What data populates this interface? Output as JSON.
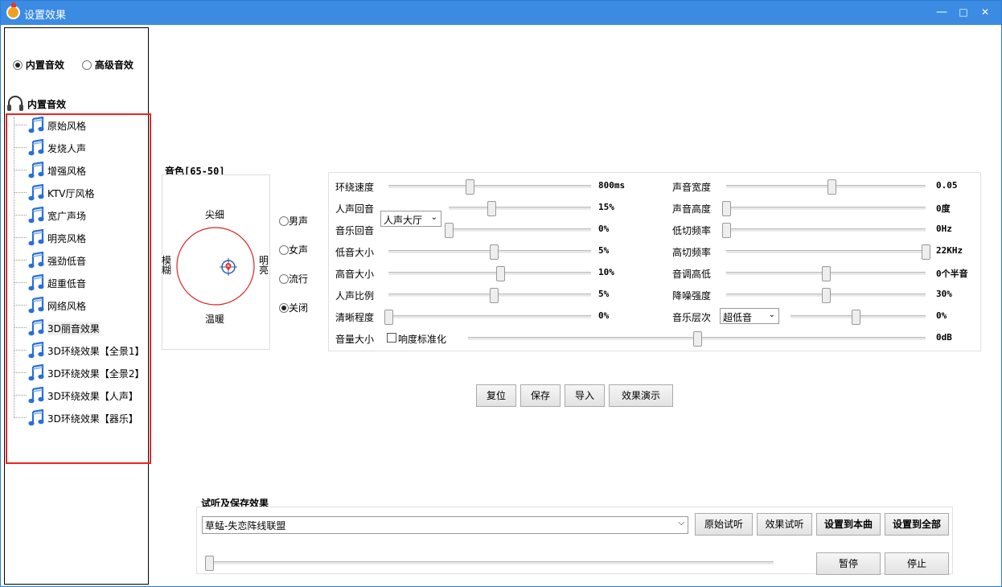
{
  "window": {
    "title": "设置效果",
    "minimize": "—",
    "maximize": "□",
    "close": "✕"
  },
  "mode": {
    "builtin_label": "内置音效",
    "advanced_label": "高级音效",
    "selected": "builtin"
  },
  "tree": {
    "root_label": "内置音效",
    "items": [
      "原始风格",
      "发烧人声",
      "增强风格",
      "KTV厅风格",
      "宽广声场",
      "明亮风格",
      "强劲低音",
      "超重低音",
      "网络风格",
      "3D丽音效果",
      "3D环绕效果【全景1】",
      "3D环绕效果【全景2】",
      "3D环绕效果【人声】",
      "3D环绕效果【器乐】"
    ],
    "selected_index": 9
  },
  "tone": {
    "title": "音色[65-50]",
    "top": "尖细",
    "bottom": "温暖",
    "left": "模糊",
    "right": "明亮",
    "voice_options": [
      {
        "label": "男声",
        "checked": false
      },
      {
        "label": "女声",
        "checked": false
      },
      {
        "label": "流行",
        "checked": false
      },
      {
        "label": "关闭",
        "checked": true
      }
    ]
  },
  "left_sliders": [
    {
      "label": "环绕速度",
      "value": "800ms",
      "level": 0.4
    },
    {
      "label": "人声回音",
      "value": "15%",
      "level": 0.3,
      "select": "人声大厅"
    },
    {
      "label": "音乐回音",
      "value": "0%",
      "level": 0.0
    },
    {
      "label": "低音大小",
      "value": "5%",
      "level": 0.52
    },
    {
      "label": "高音大小",
      "value": "10%",
      "level": 0.55
    },
    {
      "label": "人声比例",
      "value": "5%",
      "level": 0.52
    },
    {
      "label": "清晰程度",
      "value": "0%",
      "level": 0.0
    }
  ],
  "right_sliders": [
    {
      "label": "声音宽度",
      "value": "0.05",
      "level": 0.53
    },
    {
      "label": "声音高度",
      "value": "0度",
      "level": 0.0
    },
    {
      "label": "低切频率",
      "value": "0Hz",
      "level": 0.0
    },
    {
      "label": "高切频率",
      "value": "22KHz",
      "level": 1.0
    },
    {
      "label": "音调高低",
      "value": "0个半音",
      "level": 0.5
    },
    {
      "label": "降噪强度",
      "value": "30%",
      "level": 0.5
    },
    {
      "label": "音乐层次",
      "value": "0%",
      "level": 0.48,
      "select": "超低音"
    }
  ],
  "volume": {
    "label": "音量大小",
    "checkbox_label": "响度标准化",
    "checked": false,
    "value": "0dB",
    "level": 0.5
  },
  "actions": {
    "reset": "复位",
    "save": "保存",
    "import": "导入",
    "demo": "效果演示"
  },
  "preview": {
    "title": "试听及保存效果",
    "song": "草蜢-失恋阵线联盟",
    "original_btn": "原始试听",
    "effect_btn": "效果试听",
    "set_song_btn": "设置到本曲",
    "set_all_btn": "设置到全部",
    "pause_btn": "暂停",
    "stop_btn": "停止",
    "progress": 0.0
  }
}
